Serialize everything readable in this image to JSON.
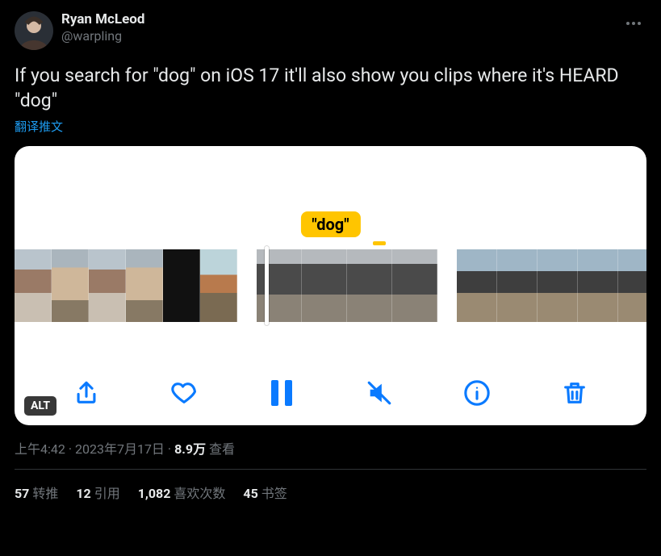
{
  "author": {
    "display_name": "Ryan McLeod",
    "handle": "@warpling"
  },
  "tweet": {
    "text": "If you search for \"dog\" on iOS 17 it'll also show you clips where it's HEARD \"dog\"",
    "translate_label": "翻译推文"
  },
  "media": {
    "search_term_label": "\"dog\"",
    "alt_badge": "ALT"
  },
  "meta": {
    "time": "上午4:42",
    "date": "2023年7月17日",
    "views_count": "8.9万",
    "views_label": "查看"
  },
  "stats": {
    "retweets": {
      "count": "57",
      "label": "转推"
    },
    "quotes": {
      "count": "12",
      "label": "引用"
    },
    "likes": {
      "count": "1,082",
      "label": "喜欢次数"
    },
    "bookmarks": {
      "count": "45",
      "label": "书签"
    }
  }
}
